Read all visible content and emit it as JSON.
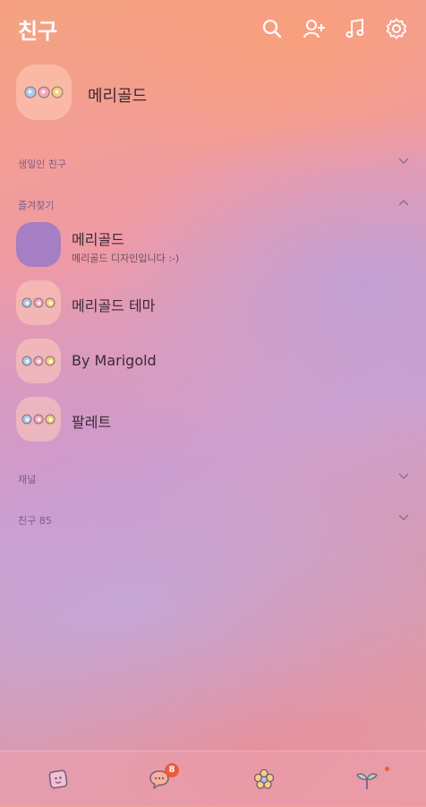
{
  "header": {
    "title": "친구",
    "icons": [
      "search-icon",
      "add-friend-icon",
      "music-icon",
      "gear-icon"
    ]
  },
  "my_profile": {
    "name": "메리골드"
  },
  "sections": {
    "birthday": "생일인 친구",
    "favorites": "즐겨찾기",
    "channel": "채널",
    "friends": "친구 85"
  },
  "favorites": [
    {
      "name": "메리골드",
      "status": "메리골드 디자인입니다 :-)",
      "avatar": "purple-square"
    },
    {
      "name": "메리골드 테마",
      "status": "",
      "avatar": "faces"
    },
    {
      "name": "By Marigold",
      "status": "",
      "avatar": "faces"
    },
    {
      "name": "팔레트",
      "status": "",
      "avatar": "faces"
    }
  ],
  "tabbar": {
    "items": [
      "friends-tab-icon",
      "chats-tab-icon",
      "view-tab-icon",
      "more-tab-icon"
    ],
    "chat_badge": "8"
  },
  "colors": {
    "accent_badge": "#ef5b37",
    "face_blue": "#a9c8e8",
    "face_pink": "#f2a7b8",
    "face_yellow": "#f2cf7a",
    "section_label": "#7c5d8e"
  }
}
